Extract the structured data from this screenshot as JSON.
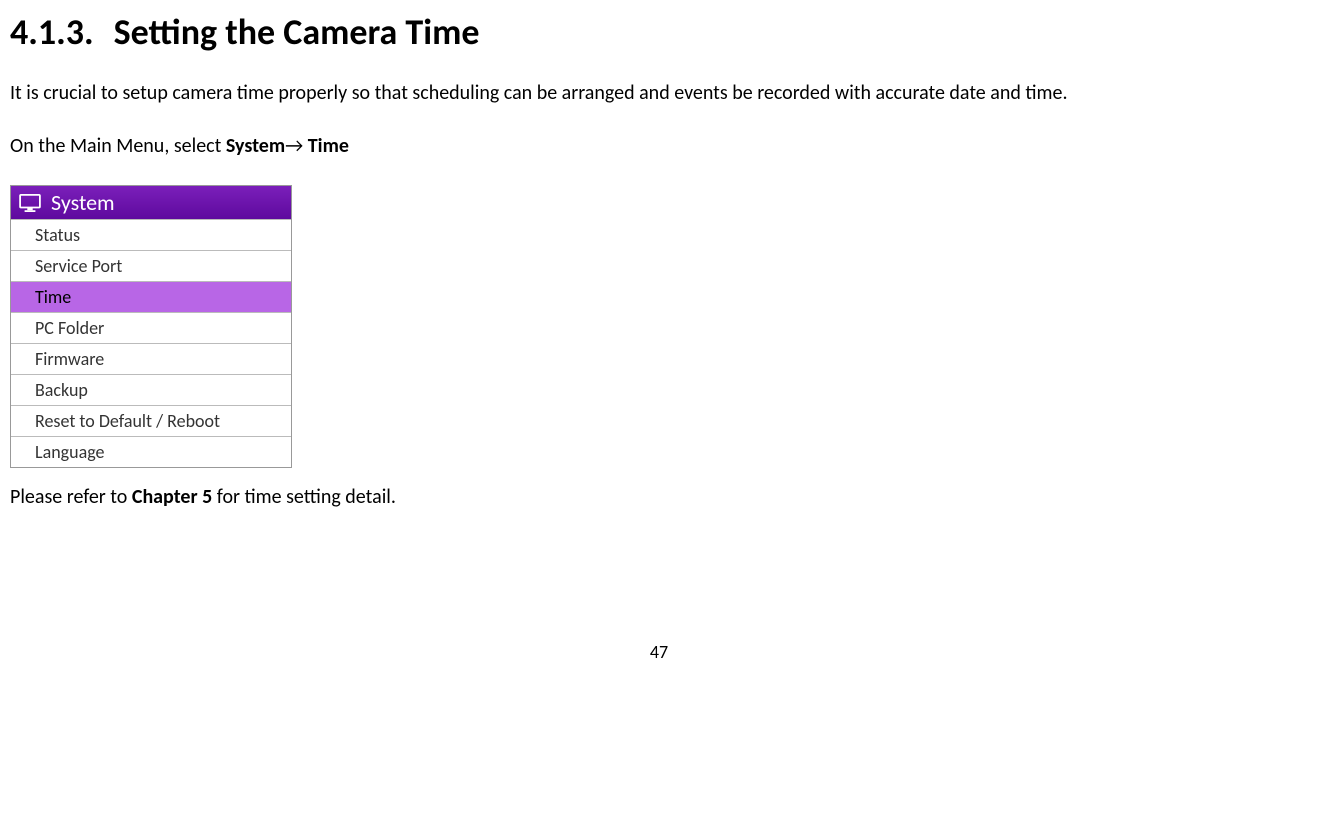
{
  "heading": {
    "number": "4.1.3.",
    "title": "Setting the Camera Time"
  },
  "intro_text": "It is crucial to setup camera time properly so that scheduling can be arranged and events be recorded with accurate date and time.",
  "instruction_prefix": "On the Main Menu, select ",
  "instruction_bold1": "System",
  "instruction_arrow": "→",
  "instruction_bold2": " Time",
  "menu": {
    "header": "System",
    "items": [
      {
        "label": "Status",
        "selected": false
      },
      {
        "label": "Service Port",
        "selected": false
      },
      {
        "label": "Time",
        "selected": true
      },
      {
        "label": "PC Folder",
        "selected": false
      },
      {
        "label": "Firmware",
        "selected": false
      },
      {
        "label": "Backup",
        "selected": false
      },
      {
        "label": "Reset to Default / Reboot",
        "selected": false
      },
      {
        "label": "Language",
        "selected": false
      }
    ]
  },
  "footer_prefix": "Please refer to ",
  "footer_bold": "Chapter 5",
  "footer_suffix": " for time setting detail.",
  "page_number": "47"
}
